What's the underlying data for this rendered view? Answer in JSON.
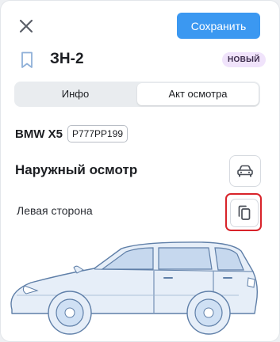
{
  "header": {
    "close_icon": "close-icon",
    "save_label": "Сохранить"
  },
  "inspection": {
    "bookmark_icon": "bookmark-icon",
    "title": "ЗН-2",
    "status_badge": "НОВЫЙ"
  },
  "tabs": [
    {
      "label": "Инфо",
      "selected": false
    },
    {
      "label": "Акт осмотра",
      "selected": true
    }
  ],
  "vehicle": {
    "model": "BMW X5",
    "plate": "Р777РР199"
  },
  "section": {
    "title": "Наружный осмотр",
    "car_view_icon": "car-front-icon"
  },
  "side": {
    "label": "Левая сторона",
    "copy_icon": "copy-icon"
  },
  "diagram": {
    "icon": "car-left-side-diagram",
    "colors": {
      "outline": "#5f7fa8",
      "fill": "#e6eef8",
      "wheel": "#cfe0f4"
    }
  },
  "colors": {
    "accent": "#3b98f1",
    "badge_bg": "#f0e3fb",
    "highlight": "#d8232a"
  }
}
